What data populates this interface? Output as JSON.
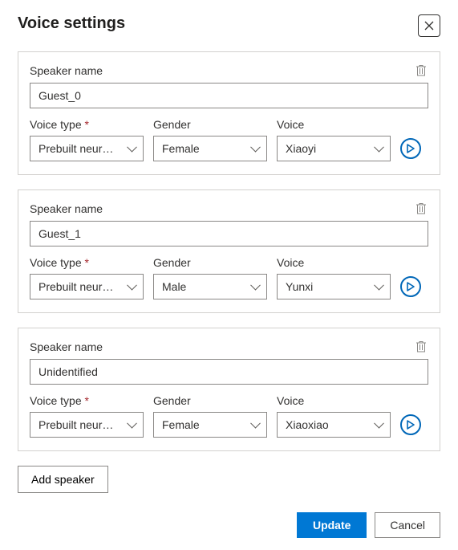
{
  "title": "Voice settings",
  "labels": {
    "speaker_name": "Speaker name",
    "voice_type": "Voice type",
    "gender": "Gender",
    "voice": "Voice"
  },
  "speakers": [
    {
      "name": "Guest_0",
      "voice_type": "Prebuilt neural ...",
      "gender": "Female",
      "voice": "Xiaoyi"
    },
    {
      "name": "Guest_1",
      "voice_type": "Prebuilt neural ...",
      "gender": "Male",
      "voice": "Yunxi"
    },
    {
      "name": "Unidentified",
      "voice_type": "Prebuilt neural ...",
      "gender": "Female",
      "voice": "Xiaoxiao"
    }
  ],
  "buttons": {
    "add_speaker": "Add speaker",
    "update": "Update",
    "cancel": "Cancel"
  }
}
